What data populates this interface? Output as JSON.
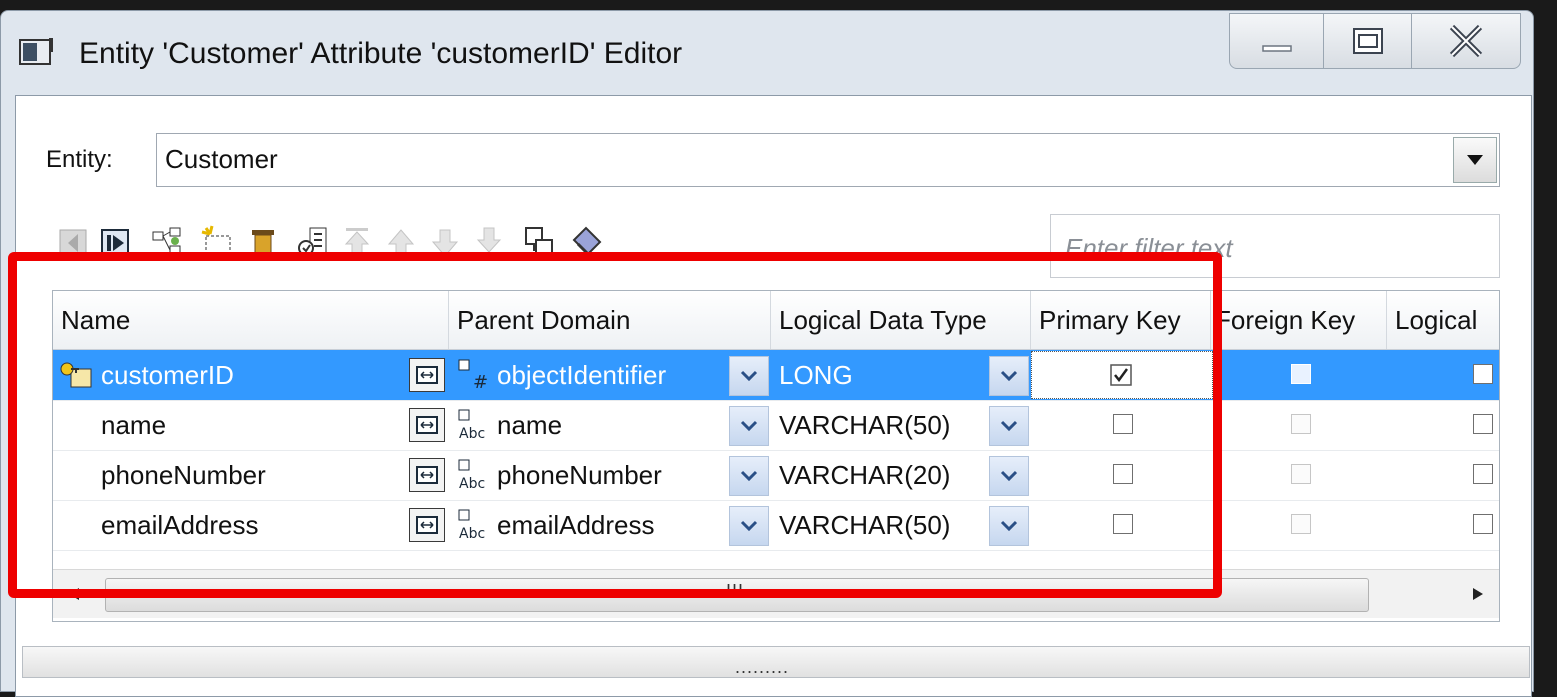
{
  "window": {
    "title": "Entity 'Customer' Attribute 'customerID' Editor",
    "controls": [
      "minimize-icon",
      "maximize-icon",
      "close-icon"
    ]
  },
  "entity": {
    "label": "Entity:",
    "value": "Customer"
  },
  "filter": {
    "placeholder": "Enter filter text"
  },
  "toolbar": {
    "icons": [
      "nav-first-icon",
      "nav-last-icon",
      "add-tree-icon",
      "new-attribute-icon",
      "delete-icon",
      "properties-icon",
      "move-top-icon",
      "move-up-icon",
      "move-down-icon",
      "move-bottom-icon",
      "copy-icon",
      "tag-icon"
    ]
  },
  "table": {
    "columns": [
      "Name",
      "Parent Domain",
      "Logical Data Type",
      "Primary Key",
      "Foreign Key",
      "Logical"
    ],
    "rows": [
      {
        "name": "customerID",
        "domain": "objectIdentifier",
        "type": "LONG",
        "primary_key": true,
        "foreign_key": false,
        "logical": false,
        "selected": true
      },
      {
        "name": "name",
        "domain": "name",
        "type": "VARCHAR(50)",
        "primary_key": false,
        "foreign_key": false,
        "logical": false,
        "selected": false
      },
      {
        "name": "phoneNumber",
        "domain": "phoneNumber",
        "type": "VARCHAR(20)",
        "primary_key": false,
        "foreign_key": false,
        "logical": false,
        "selected": false
      },
      {
        "name": "emailAddress",
        "domain": "emailAddress",
        "type": "VARCHAR(50)",
        "primary_key": false,
        "foreign_key": false,
        "logical": false,
        "selected": false
      }
    ],
    "scroll_grip": "III"
  },
  "splitter": {
    "grip": "........."
  },
  "colors": {
    "selection": "#3399ff",
    "highlight": "#ee0000"
  }
}
